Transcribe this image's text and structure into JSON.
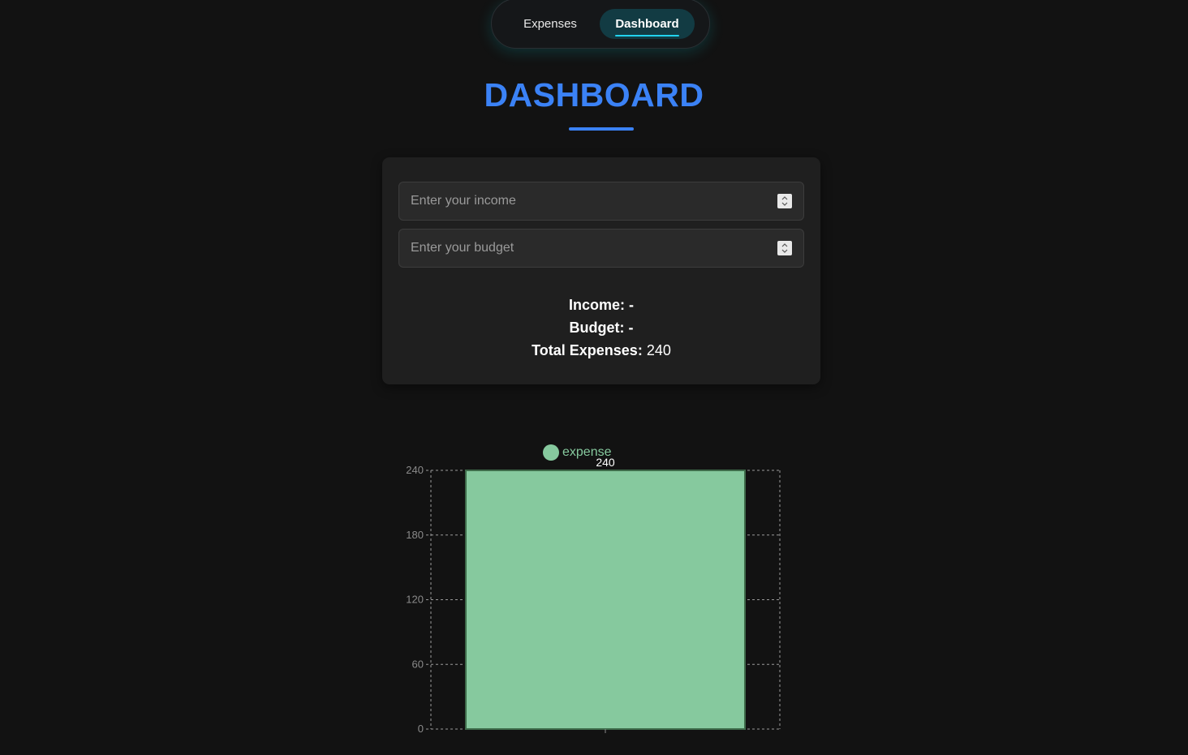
{
  "nav": {
    "expenses_label": "Expenses",
    "dashboard_label": "Dashboard",
    "active": "Dashboard"
  },
  "page": {
    "title": "DASHBOARD"
  },
  "form": {
    "income_placeholder": "Enter your income",
    "income_value": "",
    "budget_placeholder": "Enter your budget",
    "budget_value": ""
  },
  "summary": {
    "income_label": "Income:",
    "income_value": "-",
    "budget_label": "Budget:",
    "budget_value": "-",
    "total_label": "Total Expenses:",
    "total_value": "240"
  },
  "colors": {
    "accent": "#3b82f6",
    "nav_active_bg": "#123b43",
    "nav_underline": "#22d3ee",
    "bar_fill": "#86c99e",
    "bar_stroke": "#3e6b4a"
  },
  "chart_data": {
    "type": "bar",
    "categories": [
      ""
    ],
    "series": [
      {
        "name": "expense",
        "values": [
          240
        ]
      }
    ],
    "yticks": [
      0,
      60,
      120,
      180,
      240
    ],
    "ylim": [
      0,
      240
    ],
    "data_labels": [
      "240"
    ],
    "grid": true,
    "legend": "top"
  }
}
